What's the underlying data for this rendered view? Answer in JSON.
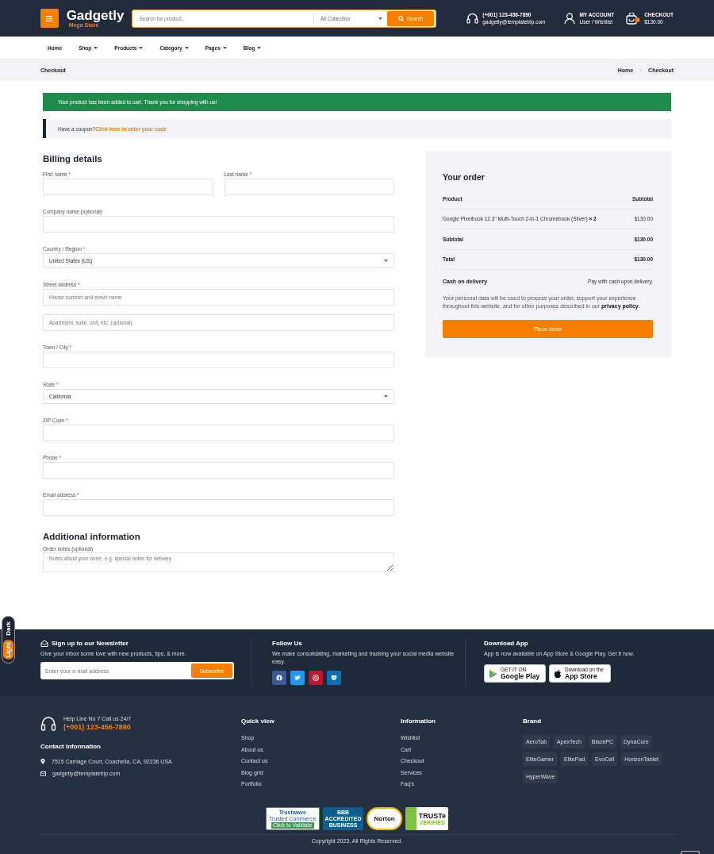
{
  "theme_toggle": {
    "options": [
      {
        "label": "Dark",
        "selected": false
      },
      {
        "label": "Light",
        "selected": true
      }
    ]
  },
  "header": {
    "logo": {
      "name": "Gadgetly",
      "tagline": "Mega Store"
    },
    "search": {
      "placeholder": "Search for product...",
      "category": "All Collection",
      "button": "Search"
    },
    "contact": {
      "phone": "(+001) 123-456-7890",
      "email": "gadgetly@templatetrip.com"
    },
    "account": {
      "title": "MY ACCOUNT",
      "subtitle": "User / Wishlist"
    },
    "cart": {
      "title": "CHECKOUT",
      "total": "$130.00"
    }
  },
  "nav": [
    {
      "label": "Home",
      "dropdown": false
    },
    {
      "label": "Shop",
      "dropdown": true
    },
    {
      "label": "Products",
      "dropdown": true
    },
    {
      "label": "Category",
      "dropdown": true
    },
    {
      "label": "Pages",
      "dropdown": true
    },
    {
      "label": "Blog",
      "dropdown": true
    }
  ],
  "breadcrumb": {
    "title": "Checkout",
    "trail": [
      "Home",
      "Checkout"
    ]
  },
  "notice": "Your product has been added to cart. Thank you for shopping with us!",
  "coupon": {
    "text": "Have a coupon?",
    "link": "Click here to enter your code"
  },
  "billing": {
    "heading": "Billing details",
    "rows": [
      {
        "fields": [
          {
            "kind": "text",
            "label": "First name",
            "mark": "*"
          },
          {
            "kind": "text",
            "label": "Last name",
            "mark": "*"
          }
        ]
      },
      {
        "fields": [
          {
            "kind": "text",
            "label": "Company name (optional)"
          }
        ]
      },
      {
        "fields": [
          {
            "kind": "select",
            "label": "Country / Region",
            "mark": "*",
            "value": "United States (US)"
          }
        ]
      },
      {
        "fields": [
          {
            "kind": "text",
            "label": "Street address",
            "mark": "*",
            "placeholder": "House number and street name"
          }
        ]
      },
      {
        "fields": [
          {
            "kind": "text",
            "placeholder": "Apartment, suite, unit, etc. (optional)"
          }
        ]
      },
      {
        "fields": [
          {
            "kind": "text",
            "label": "Town / City",
            "mark": "*"
          }
        ]
      },
      {
        "fields": [
          {
            "kind": "select",
            "label": "State",
            "mark": "*",
            "value": "California"
          }
        ]
      },
      {
        "fields": [
          {
            "kind": "text",
            "label": "ZIP Code",
            "mark": "*"
          }
        ]
      },
      {
        "fields": [
          {
            "kind": "text",
            "label": "Phone",
            "mark": "*"
          }
        ]
      },
      {
        "fields": [
          {
            "kind": "text",
            "label": "Email address",
            "mark": "*"
          }
        ]
      }
    ]
  },
  "additional": {
    "heading": "Additional information",
    "rows": [
      {
        "fields": [
          {
            "kind": "textarea",
            "label": "Order notes (optional)",
            "placeholder": "Notes about your order, e.g. special notes for delivery."
          }
        ]
      }
    ]
  },
  "order": {
    "heading": "Your order",
    "columns": [
      "Product",
      "Subtotal"
    ],
    "items": [
      {
        "name": "Google Pixelbook 12.3\" Multi-Touch 2-in-1 Chromebook (Silver)",
        "qty": "× 2",
        "price": "$130.00"
      }
    ],
    "totals": [
      {
        "label": "Subtotal",
        "value": "$130.00"
      },
      {
        "label": "Total",
        "value": "$130.00"
      }
    ],
    "payment": {
      "method": "Cash on delivery",
      "description": "Pay with cash upon delivery."
    },
    "privacy": {
      "text": "Your personal data will be used to process your order, support your experience throughout this website, and for other purposes described in our",
      "link": "privacy policy",
      "end": "."
    },
    "button": "Place order"
  },
  "newsletter": {
    "title": "Sign up to our Newsletter",
    "text": "Give your inbox some love with new products, tips, & more.",
    "placeholder": "Enter your e-mail address",
    "button": "Subscribe"
  },
  "follow": {
    "title": "Follow Us",
    "text": "We make consolidating, marketing and tracking your social media website easy.",
    "links": [
      {
        "kind": "facebook",
        "color": "#3b5a9a"
      },
      {
        "kind": "twitter",
        "color": "#1d9bf0"
      },
      {
        "kind": "instagram",
        "color": "#c0142b"
      },
      {
        "kind": "pocket",
        "color": "#0b6fb5"
      }
    ]
  },
  "app": {
    "title": "Download App",
    "text": "App is now available on App Store & Google Play. Get it now.",
    "badges": [
      {
        "kind": "google",
        "small": "GET IT ON",
        "big": "Google Play"
      },
      {
        "kind": "apple",
        "small": "Download on the",
        "big": "App Store"
      }
    ]
  },
  "footer": {
    "helpline": {
      "label": "Help Line No 7 Call us 24/7",
      "phone": "(+001) 123-456-7890"
    },
    "contact": {
      "heading": "Contact Information",
      "address": "7515 Carriage Court, Coachella, CA, 92236 USA",
      "email": "gadgetly@templatetrip.com"
    },
    "columns": [
      {
        "heading": "Quick view",
        "links": [
          "Shop",
          "About us",
          "Contact us",
          "Blog grid",
          "Portfolio"
        ]
      },
      {
        "heading": "Information",
        "links": [
          "Wishlist",
          "Cart",
          "Checkout",
          "Services",
          "Faq's"
        ]
      }
    ],
    "brand": {
      "heading": "Brand",
      "tags": [
        "AeroTab",
        "ApexTech",
        "BlazePC",
        "DynaCore",
        "EliteGamer",
        "ElitePad",
        "EvoCell",
        "HorizonTablet",
        "HyperWave"
      ]
    },
    "trust": [
      {
        "kind": "trustwave",
        "lines": [
          "Trustwave",
          "Trusted Commerce",
          "Click to Validate"
        ]
      },
      {
        "kind": "bbb",
        "lines": [
          "BBB",
          "ACCREDITED",
          "BUSINESS"
        ]
      },
      {
        "kind": "norton",
        "lines": [
          "Norton"
        ]
      },
      {
        "kind": "truste",
        "lines": [
          "TRUSTe",
          "VERIFIED"
        ]
      }
    ],
    "copyright": "Copyright 2023, All Rights Reserved."
  }
}
